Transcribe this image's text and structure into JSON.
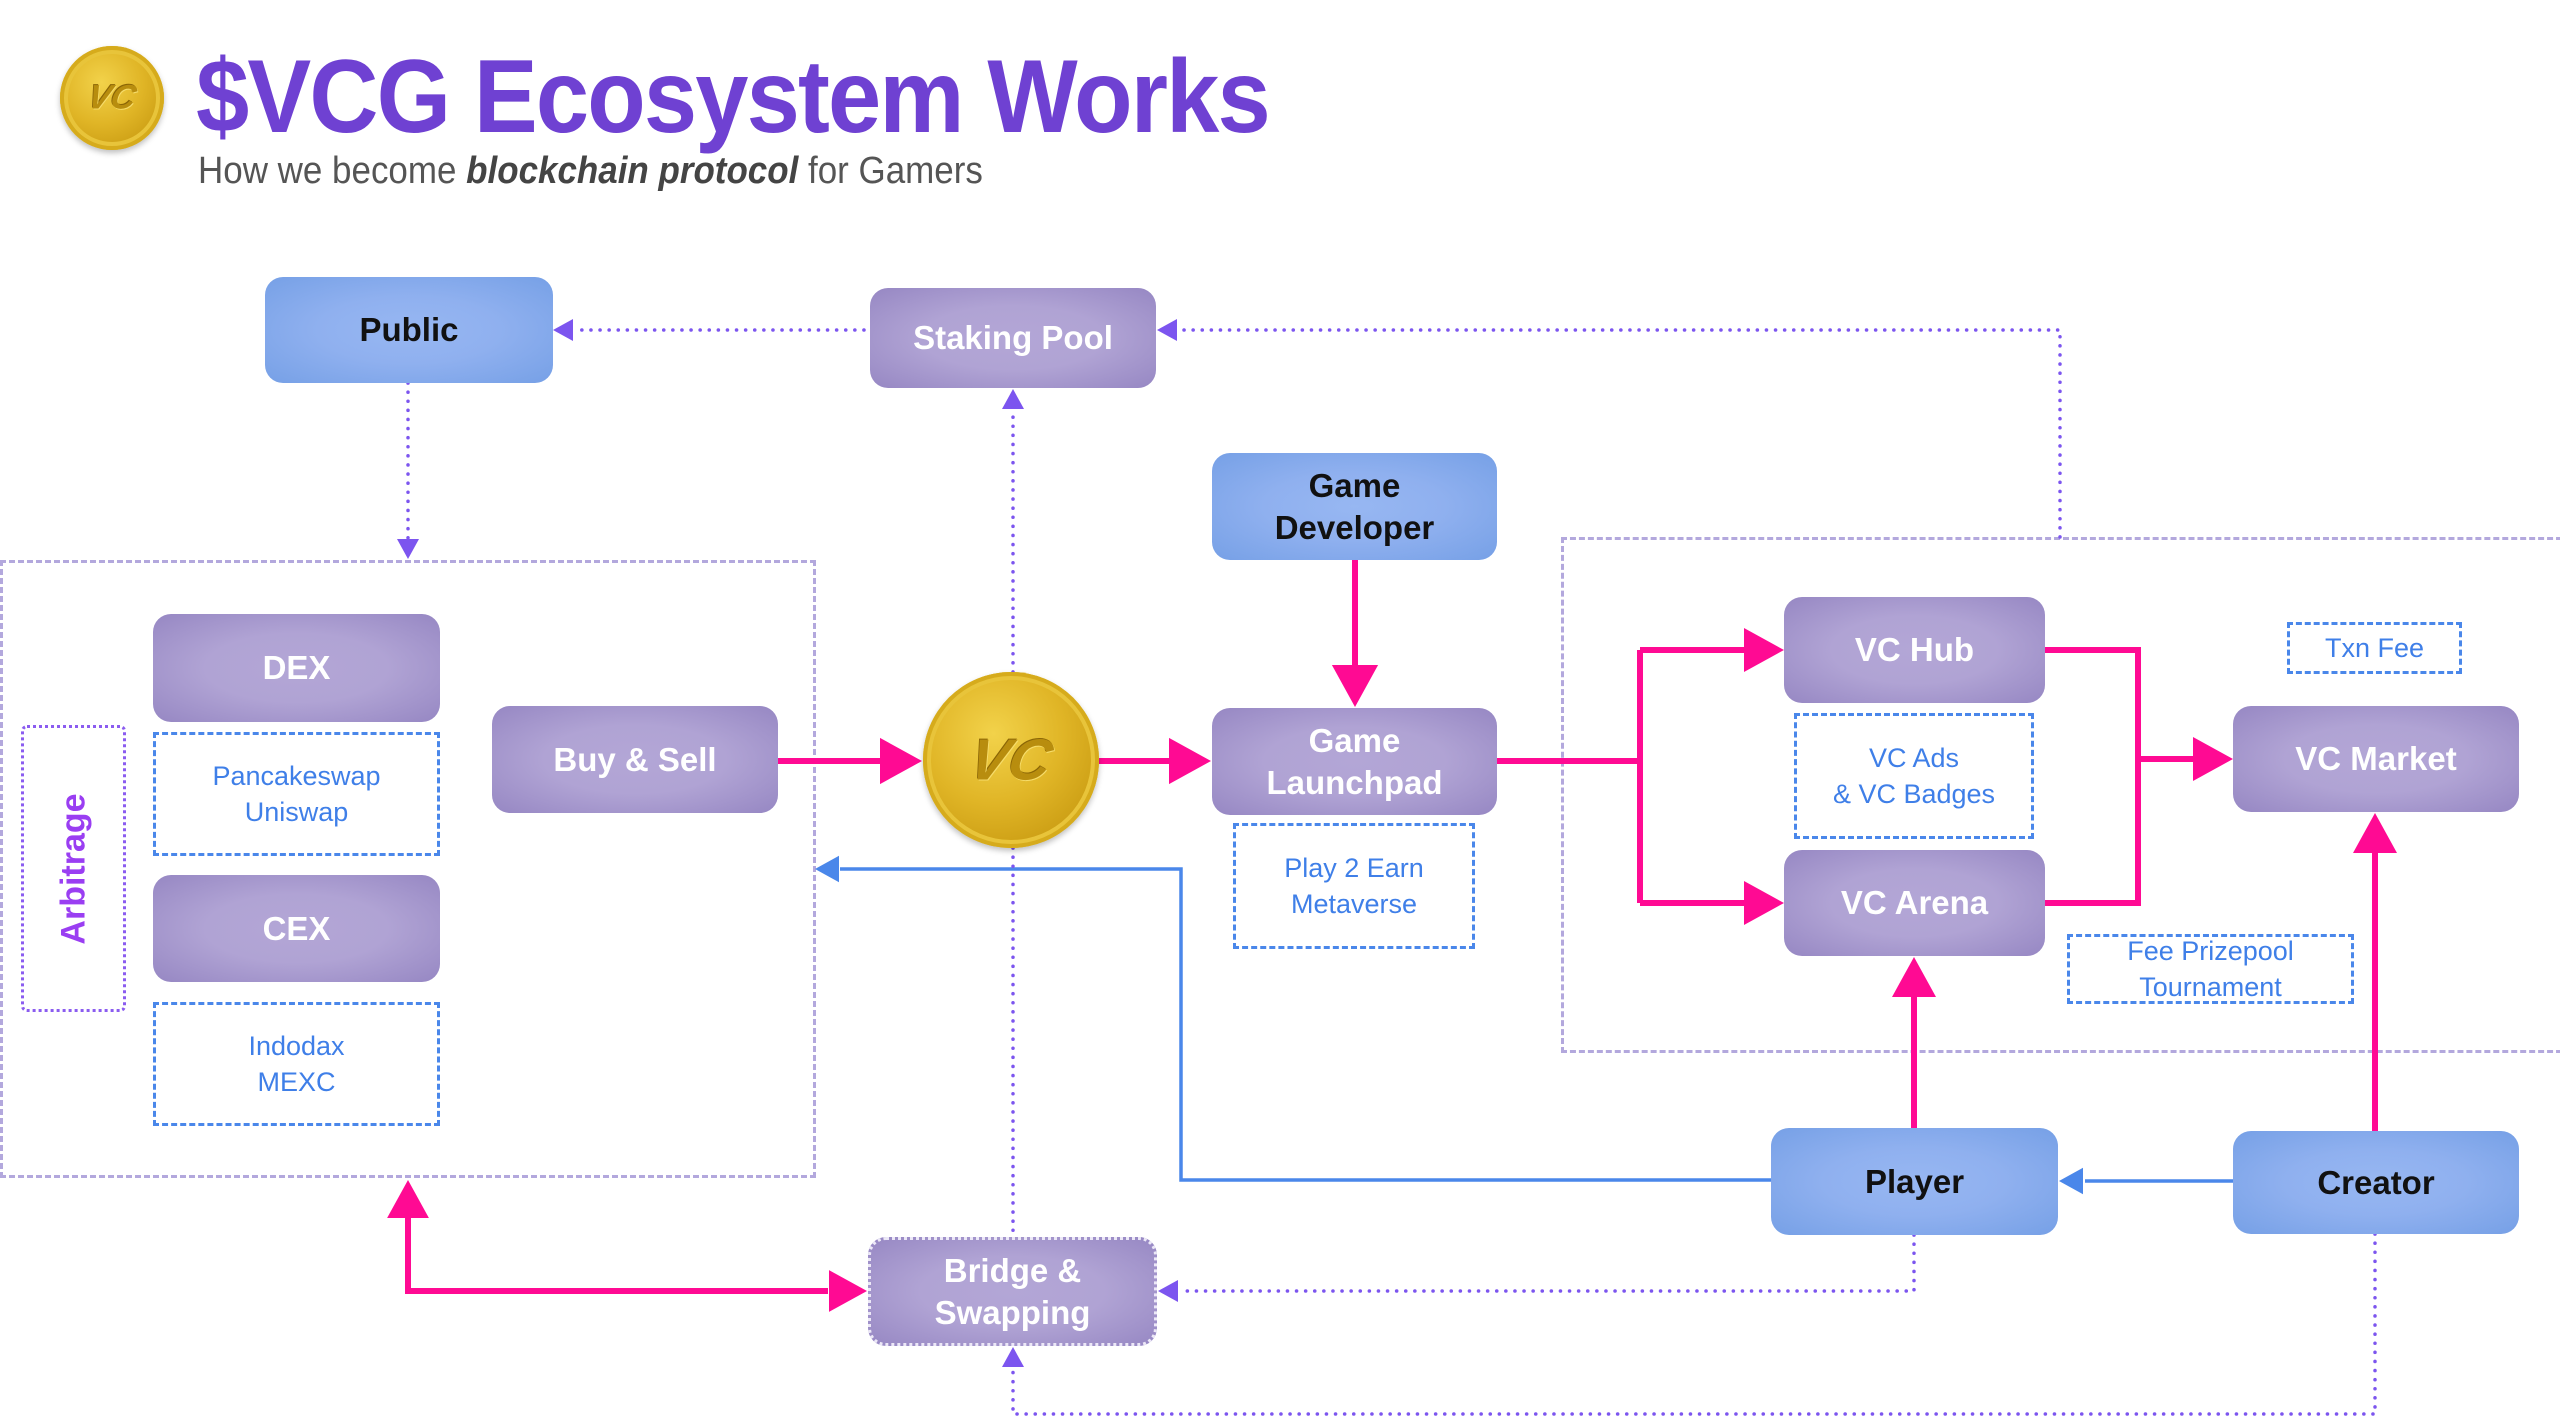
{
  "header": {
    "title": "$VCG Ecosystem Works",
    "subtitle_prefix": "How we become ",
    "subtitle_emphasis": "blockchain protocol",
    "subtitle_suffix": " for Gamers",
    "logo_icon": "vcg-coin-icon",
    "logo_mark": "VC"
  },
  "colors": {
    "title": "#6f41d2",
    "flow_arrow": "#ff0a93",
    "dotted_arrow": "#7c55ef",
    "user_arrow": "#4a87ea",
    "note_text": "#3f7fe8",
    "group_border": "#b3a8dd",
    "arbitrage": "#9a3ef2"
  },
  "nodes": {
    "public": "Public",
    "staking_pool": "Staking Pool",
    "dex": "DEX",
    "cex": "CEX",
    "buy_sell": "Buy & Sell",
    "game_developer": [
      "Game",
      "Developer"
    ],
    "game_launchpad": [
      "Game",
      "Launchpad"
    ],
    "vc_hub": "VC Hub",
    "vc_arena": "VC Arena",
    "vc_market": "VC Market",
    "player": "Player",
    "creator": "Creator",
    "bridge_swapping": [
      "Bridge &",
      "Swapping"
    ],
    "center_coin_mark": "VC"
  },
  "notes": {
    "dex_platforms": [
      "Pancakeswap",
      "Uniswap"
    ],
    "cex_platforms": [
      "Indodax",
      "MEXC"
    ],
    "launchpad_features": [
      "Play 2 Earn",
      "Metaverse"
    ],
    "hub_features": [
      "VC Ads",
      "& VC Badges"
    ],
    "txn_fee": "Txn Fee",
    "arena_fees": [
      "Fee Prizepool",
      "Tournament"
    ]
  },
  "arbitrage_label": "Arbitrage"
}
